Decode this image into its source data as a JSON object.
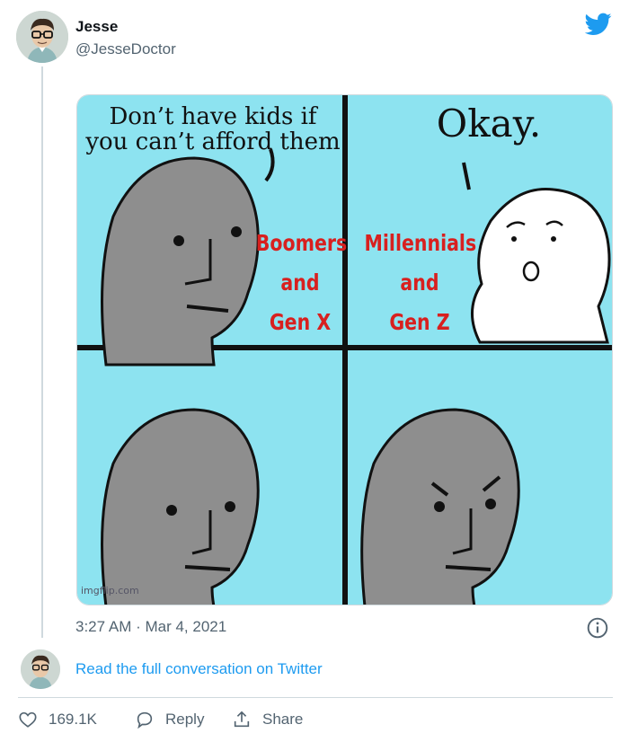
{
  "tweet": {
    "author_name": "Jesse",
    "author_handle": "@JesseDoctor",
    "timestamp": "3:27 AM · Mar 4, 2021",
    "read_conversation": "Read the full conversation on Twitter"
  },
  "meme": {
    "panel1_text_line1": "Don’t have kids if",
    "panel1_text_line2": "you can’t afford them",
    "panel2_text": "Okay.",
    "left_label": [
      "Boomers",
      "and",
      "Gen X"
    ],
    "right_label": [
      "Millennials",
      "and",
      "Gen Z"
    ],
    "watermark": "imgflip.com"
  },
  "actions": {
    "likes": "169.1K",
    "reply": "Reply",
    "share": "Share"
  },
  "colors": {
    "link": "#1d9bf0",
    "meme_background": "#8de3f0",
    "label_red": "#d8201f",
    "twitter_blue": "#1d9bf0"
  },
  "icons": [
    "twitter-bird-icon",
    "info-icon",
    "heart-icon",
    "reply-bubble-icon",
    "share-icon"
  ]
}
